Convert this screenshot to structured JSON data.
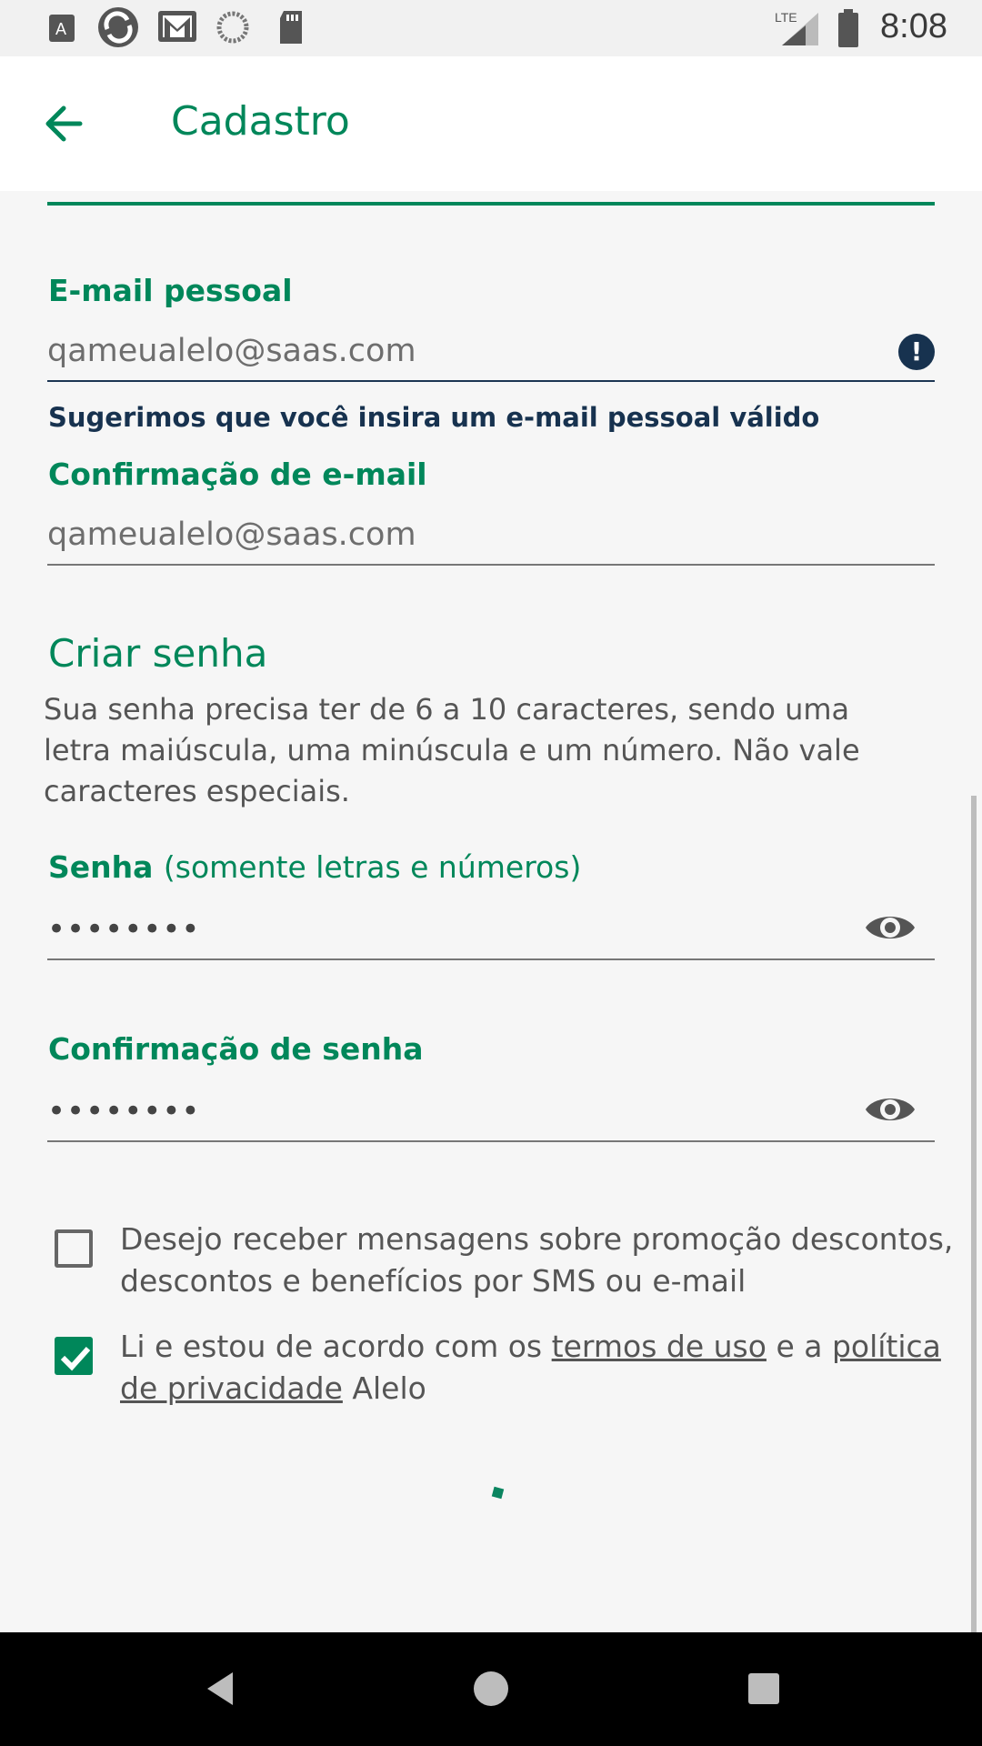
{
  "status_bar": {
    "time": "8:08",
    "network": "LTE",
    "icons": [
      "a-notification-icon",
      "sync-icon",
      "gmail-icon",
      "loading-circle-icon",
      "sd-card-icon",
      "signal-icon",
      "battery-icon"
    ]
  },
  "app_bar": {
    "title": "Cadastro",
    "back_icon": "arrow-left-icon"
  },
  "form": {
    "email": {
      "label": "E-mail pessoal",
      "value": "qameualelo@saas.com",
      "hint": "Sugerimos que você insira um e-mail pessoal válido"
    },
    "email_confirm": {
      "label": "Confirmação de e-mail",
      "value": "qameualelo@saas.com"
    },
    "password_section": {
      "title": "Criar senha",
      "description": "Sua senha precisa ter de 6 a 10 caracteres, sendo uma letra maiúscula, uma minúscula e um número. Não vale caracteres especiais."
    },
    "password": {
      "label": "Senha",
      "label_suffix": "(somente letras e números)",
      "masked_value": "••••••••"
    },
    "password_confirm": {
      "label": "Confirmação de senha",
      "masked_value": "••••••••"
    },
    "marketing_opt_in": {
      "checked": false,
      "text": "Desejo receber mensagens sobre promoção descontos, descontos e benefícios por SMS ou e-mail"
    },
    "terms": {
      "checked": true,
      "text_before": "Li e estou de acordo com os",
      "link_terms": "termos de uso",
      "text_middle": "e a",
      "link_privacy": "política de privacidade",
      "text_after": "Alelo"
    }
  },
  "colors": {
    "brand_green": "#00875a",
    "navy": "#17324f",
    "background": "#f6f6f6"
  }
}
